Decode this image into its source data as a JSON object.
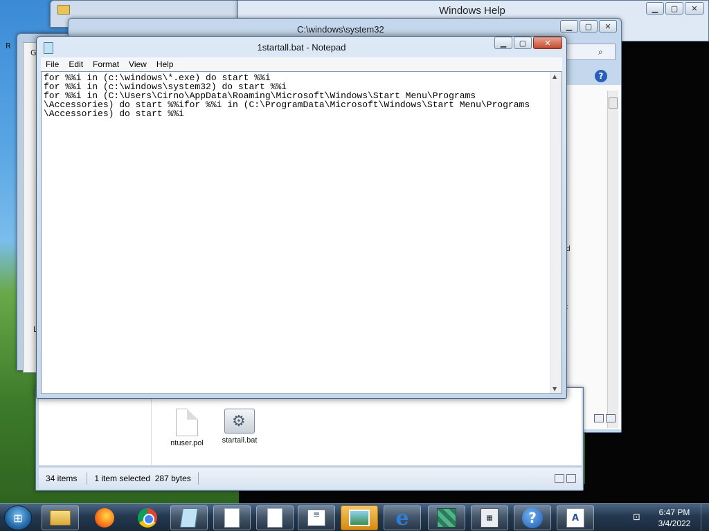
{
  "notepad": {
    "title": "1startall.bat - Notepad",
    "menu": [
      "File",
      "Edit",
      "Format",
      "View",
      "Help"
    ],
    "content": "for %%i in (c:\\windows\\*.exe) do start %%i\nfor %%i in (c:\\windows\\system32) do start %%i\nfor %%i in (C:\\Users\\Cirno\\AppData\\Roaming\\Microsoft\\Windows\\Start Menu\\Programs\n\\Accessories) do start %%ifor %%i in (C:\\ProgramData\\Microsoft\\Windows\\Start Menu\\Programs\n\\Accessories) do start %%i",
    "controls": {
      "minimize": "▁",
      "maximize": "▢",
      "close": "✕"
    }
  },
  "help_window": {
    "title": "Windows Help"
  },
  "explorer": {
    "title": "C:\\windows\\system32",
    "files": [
      {
        "name": "ntuser.pol",
        "icon": "document-icon"
      },
      {
        "name": "startall.bat",
        "icon": "batch-file-icon"
      }
    ],
    "status": {
      "items": "34 items",
      "selected": "1 item selected  287 bytes"
    },
    "side_fragments": {
      "d": "d",
      "at": "at"
    }
  },
  "back_window": {
    "fragment_ge": "Ge",
    "fragment_l": "L",
    "fragment_r": "R"
  },
  "taskbar": {
    "apps": [
      "windows-explorer-icon",
      "firefox-icon",
      "chrome-icon",
      "notepad-icon",
      "document-icon",
      "document-icon",
      "list-icon",
      "photo-viewer-icon",
      "internet-explorer-icon",
      "cubes-icon",
      "calculator-icon",
      "help-icon",
      "wordpad-icon"
    ],
    "clock": {
      "time": "6:47 PM",
      "date": "3/4/2022"
    }
  }
}
